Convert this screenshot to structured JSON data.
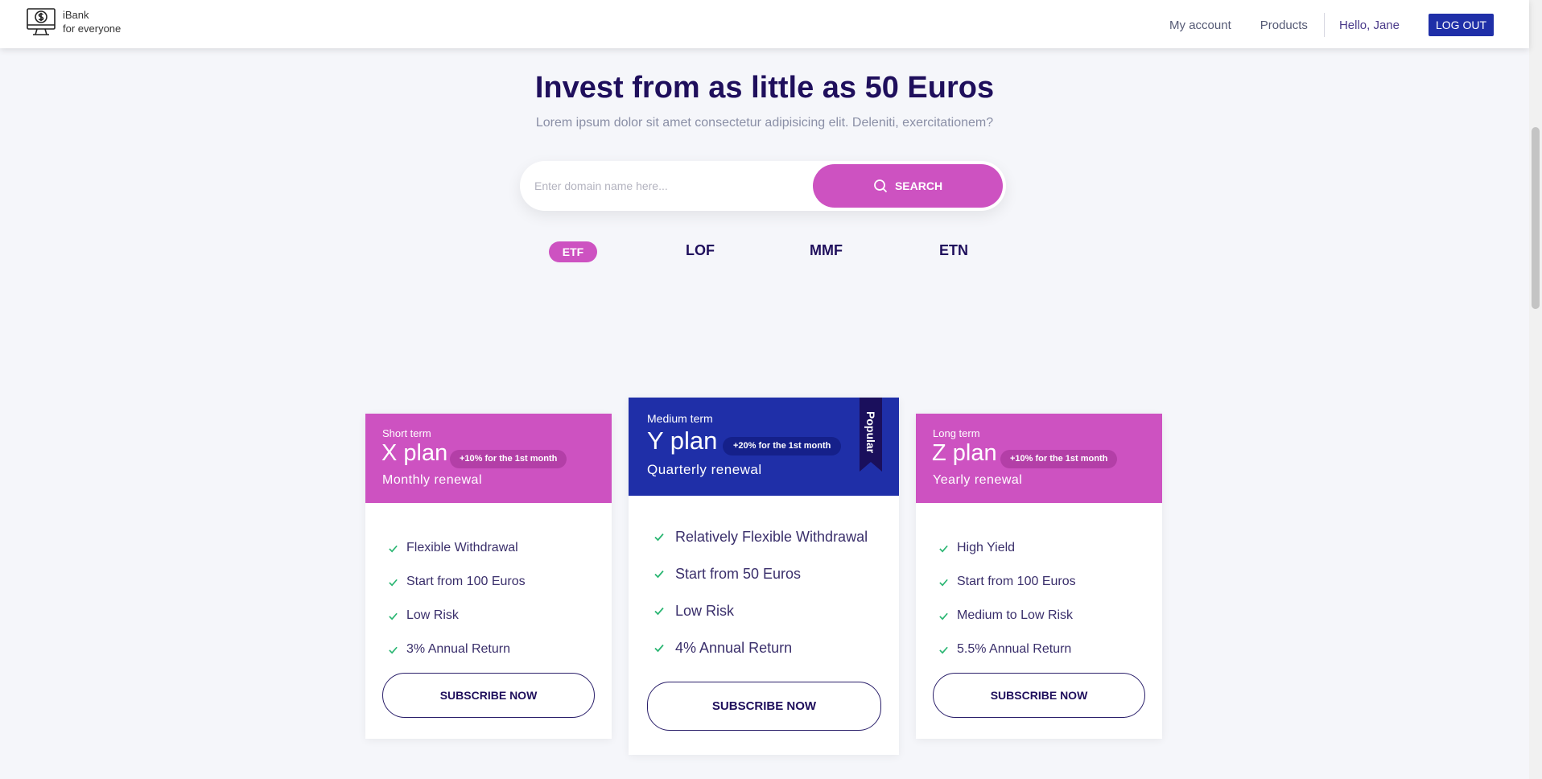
{
  "header": {
    "brand_line1": "iBank",
    "brand_line2": "for everyone",
    "nav": [
      "My account",
      "Products"
    ],
    "greeting": "Hello, Jane",
    "logout": "LOG OUT"
  },
  "hero": {
    "title": "Invest from as little as 50 Euros",
    "subtitle": "Lorem ipsum dolor sit amet consectetur adipisicing elit. Deleniti, exercitationem?"
  },
  "search": {
    "placeholder": "Enter domain name here...",
    "button": "SEARCH"
  },
  "tabs": [
    "ETF",
    "LOF",
    "MMF",
    "ETN"
  ],
  "active_tab": "ETF",
  "plans": [
    {
      "term": "Short term",
      "name": "X plan",
      "bonus": "+10% for the 1st month",
      "renewal": "Monthly renewal",
      "features": [
        "Flexible Withdrawal",
        "Start from 100 Euros",
        "Low Risk",
        "3% Annual Return"
      ],
      "cta": "SUBSCRIBE NOW"
    },
    {
      "term": "Medium term",
      "name": "Y plan",
      "bonus": "+20% for the 1st month",
      "renewal": "Quarterly renewal",
      "ribbon": "Popular",
      "features": [
        "Relatively Flexible Withdrawal",
        "Start from 50 Euros",
        "Low Risk",
        "4% Annual Return"
      ],
      "cta": "SUBSCRIBE NOW"
    },
    {
      "term": "Long term",
      "name": "Z plan",
      "bonus": "+10% for the 1st month",
      "renewal": "Yearly renewal",
      "features": [
        "High Yield",
        "Start from 100 Euros",
        "Medium to Low Risk",
        "5.5% Annual Return"
      ],
      "cta": "SUBSCRIBE NOW"
    }
  ],
  "colors": {
    "accent_pink": "#cd52c1",
    "accent_blue": "#1f2fa8",
    "heading": "#1f0f5c",
    "check": "#2bb673"
  }
}
